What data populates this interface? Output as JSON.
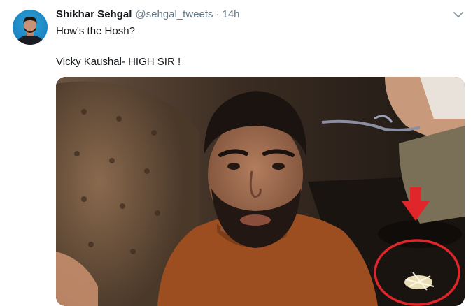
{
  "tweet": {
    "author_name": "Shikhar Sehgal",
    "author_handle": "@sehgal_tweets",
    "separator": "·",
    "timestamp": "14h",
    "text_lines": [
      "How's the Hosh?",
      "Vicky Kaushal- HIGH SIR !"
    ]
  },
  "icons": {
    "avatar": "avatar-icon",
    "menu": "chevron-down-icon",
    "annotation_arrow": "red-down-arrow-icon",
    "annotation_circle": "red-circle-annotation"
  },
  "colors": {
    "text_primary": "#14171a",
    "text_secondary": "#657786",
    "annotation_red": "#e0262b"
  }
}
